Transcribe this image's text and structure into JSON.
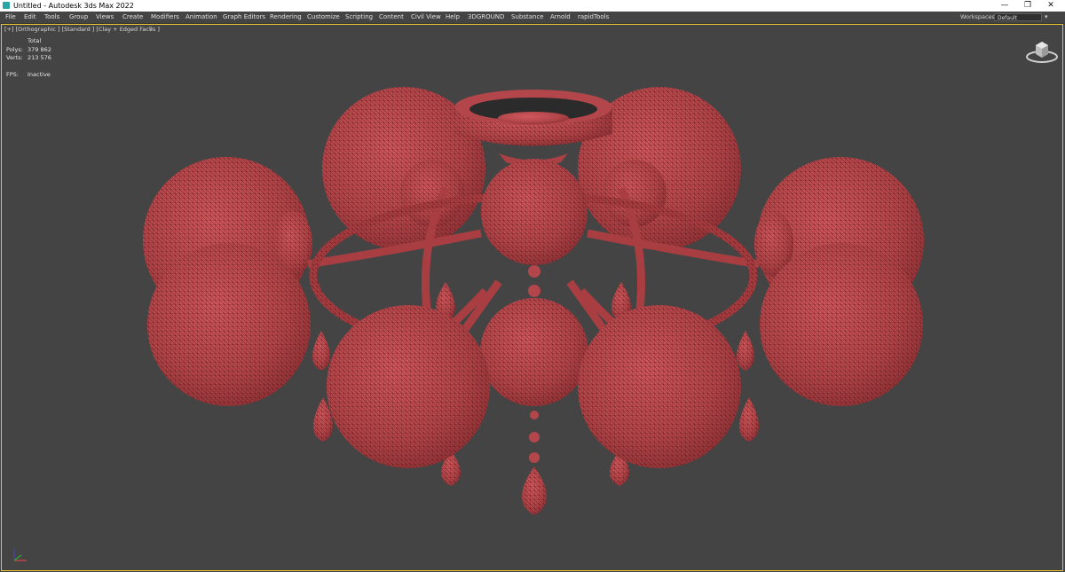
{
  "titlebar": {
    "title": "Untitled - Autodesk 3ds Max 2022",
    "minimize_icon": "minimize-icon",
    "restore_icon": "restore-icon",
    "close_icon": "close-icon",
    "minimize_glyph": "—",
    "restore_glyph": "❐",
    "close_glyph": "✕"
  },
  "menubar": {
    "items": [
      "File",
      "Edit",
      "Tools",
      "Group",
      "Views",
      "Create",
      "Modifiers",
      "Animation",
      "Graph Editors",
      "Rendering",
      "Customize",
      "Scripting",
      "Content",
      "Civil View",
      "Help",
      "3DGROUND",
      "Substance",
      "Arnold",
      "rapidTools"
    ],
    "workspaces_label": "Workspaces:",
    "workspaces_value": "Default"
  },
  "viewport": {
    "label": "[+] [Orthographic ] [Standard ] [Clay + Edged Faces ]",
    "filter_icon": "filter-icon",
    "filter_glyph": "⊽",
    "stats": {
      "total_label": "Total",
      "polys_label": "Polys:",
      "polys_value": "379 862",
      "verts_label": "Verts:",
      "verts_value": "213 576",
      "fps_label": "FPS:",
      "fps_value": "Inactive"
    },
    "viewcube_icon": "viewcube-icon",
    "axis_icon": "axis-gizmo-icon"
  },
  "colors": {
    "accent_border": "#e8c22a",
    "viewport_bg": "#444444",
    "clay": "#b5474b"
  }
}
